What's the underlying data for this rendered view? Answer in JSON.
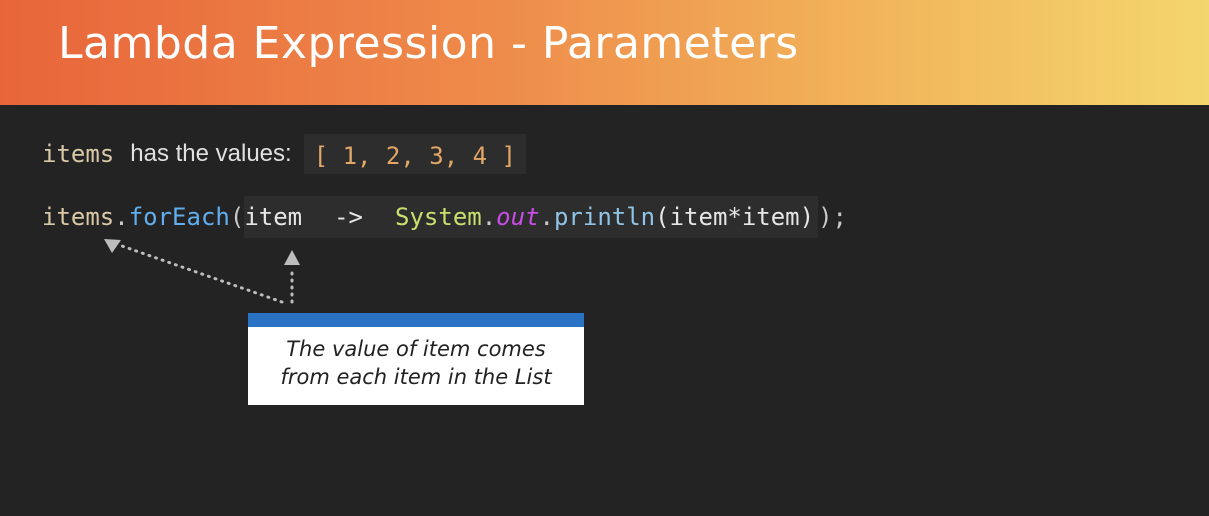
{
  "slide": {
    "title": "Lambda Expression - Parameters"
  },
  "line1": {
    "var_name": "items",
    "text": "has the values:",
    "values": "[ 1, 2, 3, 4 ]"
  },
  "code": {
    "receiver": "items",
    "dot1": ".",
    "method": "forEach",
    "open_paren": "(",
    "param": "item",
    "arrow": "->",
    "class_name": "System",
    "dot2": ".",
    "field": "out",
    "dot3": ".",
    "call": "println",
    "args": "(item*item)",
    "close": ");"
  },
  "callout": {
    "line1": "The value of item comes",
    "line2": "from each item in the List",
    "bar_color": "#2a73c4"
  },
  "colors": {
    "header_start": "#e8653a",
    "header_end": "#f3d66e",
    "background": "#232323",
    "method": "#61aeee",
    "class": "#c9e06f",
    "field": "#c84ee6",
    "array": "#e2a766"
  }
}
